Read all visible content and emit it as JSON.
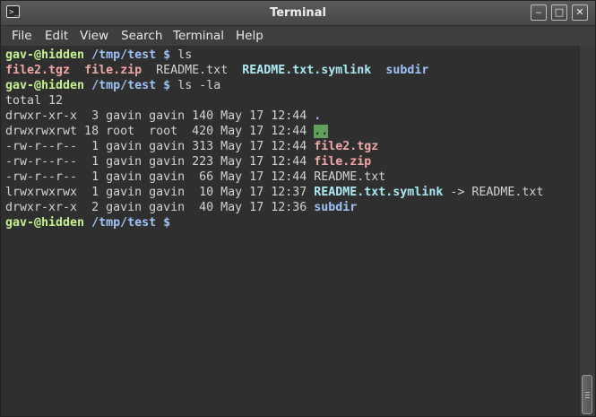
{
  "window": {
    "title": "Terminal",
    "app_icon_glyph": ">_",
    "controls": {
      "minimize": "‒",
      "maximize": "□",
      "close": "✕"
    }
  },
  "menubar": [
    "File",
    "Edit",
    "View",
    "Search",
    "Terminal",
    "Help"
  ],
  "terminal": {
    "prompt": {
      "user": "gav-@hidden",
      "path": "/tmp/test",
      "symbol": "$"
    },
    "commands": [
      "ls",
      "ls -la"
    ],
    "ls_output": [
      "file2.tgz",
      "file.zip",
      "README.txt",
      "README.txt.symlink",
      "subdir"
    ],
    "total": "total 12",
    "listing": [
      {
        "perms": "drwxr-xr-x",
        "links": "3",
        "owner": "gavin",
        "group": "gavin",
        "size": "140",
        "date": "May 17 12:44",
        "name": ".",
        "style": "blue"
      },
      {
        "perms": "drwxrwxrwt",
        "links": "18",
        "owner": "root",
        "group": "root",
        "size": "420",
        "date": "May 17 12:44",
        "name": "..",
        "style": "hl"
      },
      {
        "perms": "-rw-r--r--",
        "links": "1",
        "owner": "gavin",
        "group": "gavin",
        "size": "313",
        "date": "May 17 12:44",
        "name": "file2.tgz",
        "style": "red"
      },
      {
        "perms": "-rw-r--r--",
        "links": "1",
        "owner": "gavin",
        "group": "gavin",
        "size": "223",
        "date": "May 17 12:44",
        "name": "file.zip",
        "style": "red"
      },
      {
        "perms": "-rw-r--r--",
        "links": "1",
        "owner": "gavin",
        "group": "gavin",
        "size": "66",
        "date": "May 17 12:44",
        "name": "README.txt",
        "style": "plain"
      },
      {
        "perms": "lrwxrwxrwx",
        "links": "1",
        "owner": "gavin",
        "group": "gavin",
        "size": "10",
        "date": "May 17 12:37",
        "name": "README.txt.symlink",
        "style": "cyan",
        "target": "README.txt"
      },
      {
        "perms": "drwxr-xr-x",
        "links": "2",
        "owner": "gavin",
        "group": "gavin",
        "size": "40",
        "date": "May 17 12:36",
        "name": "subdir",
        "style": "blue"
      }
    ],
    "symlink_arrow": "->",
    "colors": {
      "background": "#2f2f2f",
      "text": "#d3d3d3",
      "prompt_user": "#c4f28f",
      "prompt_path": "#9ec3f7",
      "archive": "#f3a6a6",
      "directory": "#9ec3f7",
      "symlink": "#a9e9f2",
      "sticky_dir_bg": "#5fa05a"
    }
  }
}
